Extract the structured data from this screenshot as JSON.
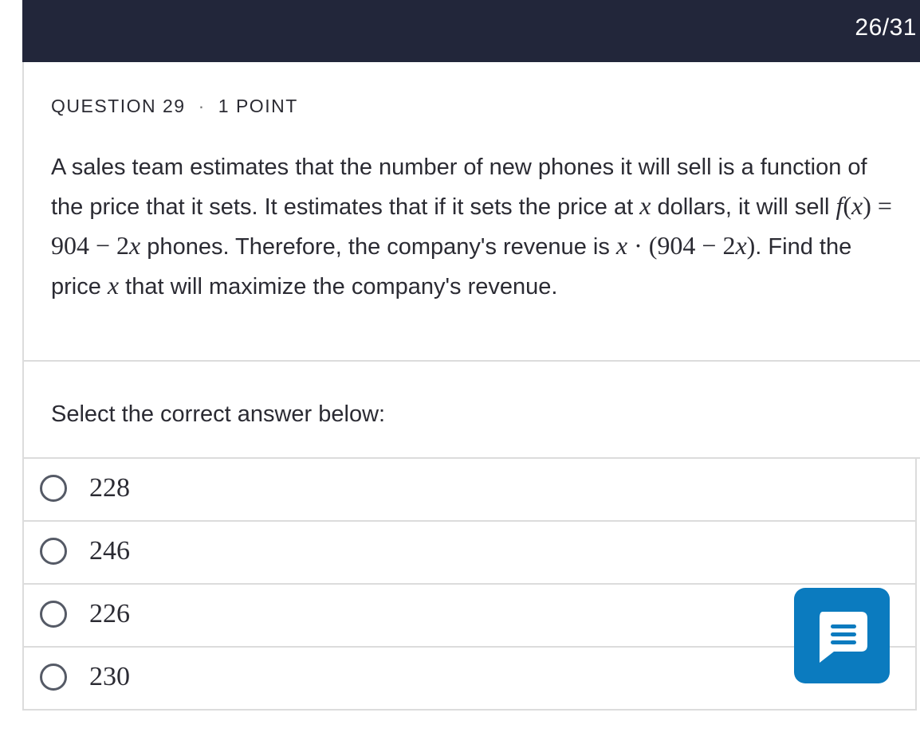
{
  "header": {
    "progress": "26/31"
  },
  "question": {
    "number_label": "QUESTION 29",
    "separator": "·",
    "points_label": "1 POINT",
    "text_part1": "A sales team estimates that the number of new phones it will sell is a function of the price that it sets. It estimates that if it sets the price at ",
    "var_x": "x",
    "text_part2": " dollars, it will sell ",
    "func_f": "f",
    "func_open": "(",
    "func_close": ")",
    "eq_rhs_num": " = 904 − 2",
    "text_part3": " phones. Therefore, the company's revenue is ",
    "revenue_mid": " · (904 − 2",
    "revenue_close": ")",
    "text_part4": ". Find the price ",
    "text_part5": " that will maximize the company's revenue."
  },
  "answers": {
    "instruction": "Select the correct answer below:",
    "options": [
      {
        "label": "228"
      },
      {
        "label": "246"
      },
      {
        "label": "226"
      },
      {
        "label": "230"
      }
    ]
  },
  "chat": {
    "icon": "chat-bubble-icon",
    "color": "#0b7bbf"
  }
}
